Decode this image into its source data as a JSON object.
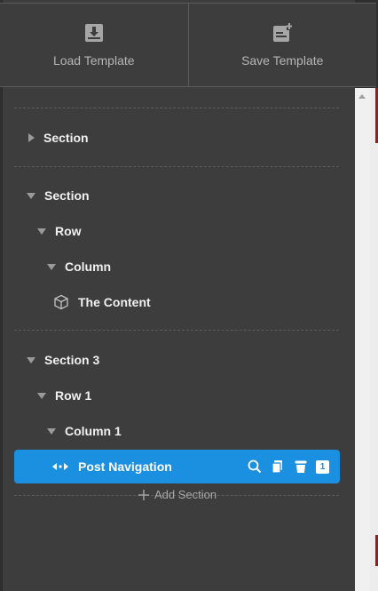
{
  "toolbar": {
    "load_label": "Load Template",
    "save_label": "Save Template"
  },
  "tree": {
    "section_1": "Section",
    "section_2": "Section",
    "row_2": "Row",
    "column_2": "Column",
    "content_2": "The Content",
    "section_3": "Section 3",
    "row_3": "Row 1",
    "column_3": "Column 1",
    "selected_module": "Post Navigation",
    "selected_badge": "1"
  },
  "add_section_label": "Add Section",
  "colors": {
    "panel_bg": "#3d3d3d",
    "selected_bg": "#1b8fe0",
    "text": "#f0f0f0",
    "muted": "#a9a9a9"
  },
  "icons": [
    "download-icon",
    "save-template-icon",
    "cube-icon",
    "nav-arrows-icon",
    "search-icon",
    "copy-icon",
    "trash-icon",
    "plus-icon"
  ]
}
